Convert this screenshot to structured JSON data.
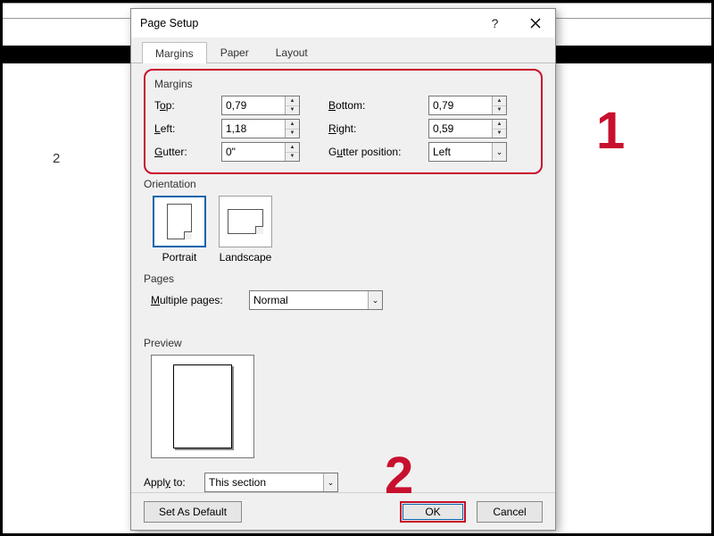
{
  "background": {
    "page_number": "2"
  },
  "dialog": {
    "title": "Page Setup",
    "tabs": [
      "Margins",
      "Paper",
      "Layout"
    ],
    "active_tab": 0
  },
  "margins": {
    "group_label": "Margins",
    "top_label_pre": "T",
    "top_label_u": "o",
    "top_label_post": "p:",
    "top_value": "0,79",
    "bottom_label_pre": "",
    "bottom_label_u": "B",
    "bottom_label_post": "ottom:",
    "bottom_value": "0,79",
    "left_label_pre": "",
    "left_label_u": "L",
    "left_label_post": "eft:",
    "left_value": "1,18",
    "right_label_pre": "",
    "right_label_u": "R",
    "right_label_post": "ight:",
    "right_value": "0,59",
    "gutter_label_pre": "",
    "gutter_label_u": "G",
    "gutter_label_post": "utter:",
    "gutter_value": "0\"",
    "gpos_label_pre": "G",
    "gpos_label_u": "u",
    "gpos_label_post": "tter position:",
    "gpos_value": "Left"
  },
  "orientation": {
    "group_label": "Orientation",
    "portrait": "Portrait",
    "landscape": "Landscape",
    "active": "portrait"
  },
  "pages": {
    "group_label": "Pages",
    "multiple_pre": "",
    "multiple_u": "M",
    "multiple_post": "ultiple pages:",
    "multiple_value": "Normal"
  },
  "preview": {
    "group_label": "Preview"
  },
  "apply": {
    "label_pre": "Appl",
    "label_u": "y",
    "label_post": " to:",
    "value": "This section"
  },
  "footer": {
    "set_default": "Set As Default",
    "ok": "OK",
    "cancel": "Cancel"
  },
  "callouts": {
    "one": "1",
    "two": "2"
  }
}
